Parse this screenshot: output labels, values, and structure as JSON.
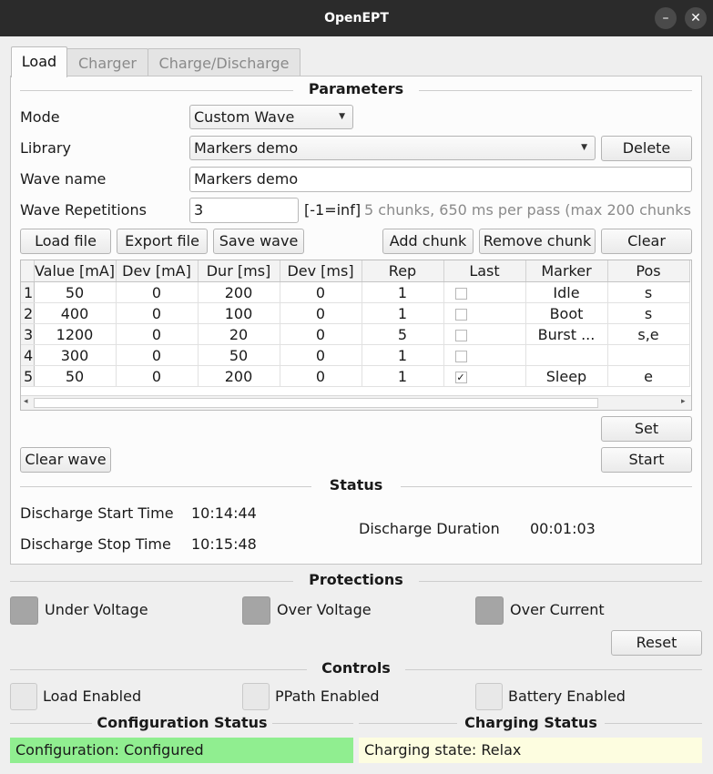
{
  "window": {
    "title": "OpenEPT",
    "minimize_glyph": "–",
    "close_glyph": "✕"
  },
  "tabs": [
    {
      "label": "Load",
      "active": true
    },
    {
      "label": "Charger",
      "active": false
    },
    {
      "label": "Charge/Discharge",
      "active": false
    }
  ],
  "parameters": {
    "title": "Parameters",
    "mode_label": "Mode",
    "mode_value": "Custom Wave",
    "library_label": "Library",
    "library_value": "Markers demo",
    "delete_label": "Delete",
    "wave_name_label": "Wave name",
    "wave_name_value": "Markers demo",
    "repetitions_label": "Wave Repetitions",
    "repetitions_value": "3",
    "repetitions_hint": "[-1=inf]",
    "chunk_info": "5 chunks, 650 ms per pass (max 200 chunks",
    "buttons": {
      "load_file": "Load file",
      "export_file": "Export file",
      "save_wave": "Save wave",
      "add_chunk": "Add chunk",
      "remove_chunk": "Remove chunk",
      "clear": "Clear"
    }
  },
  "table": {
    "columns": [
      "Value [mA]",
      "Dev [mA]",
      "Dur [ms]",
      "Dev [ms]",
      "Rep",
      "Last",
      "Marker",
      "Pos"
    ],
    "rows": [
      {
        "n": "1",
        "value": "50",
        "dev_ma": "0",
        "dur": "200",
        "dev_ms": "0",
        "rep": "1",
        "last": false,
        "marker": "Idle",
        "pos": "s"
      },
      {
        "n": "2",
        "value": "400",
        "dev_ma": "0",
        "dur": "100",
        "dev_ms": "0",
        "rep": "1",
        "last": false,
        "marker": "Boot",
        "pos": "s"
      },
      {
        "n": "3",
        "value": "1200",
        "dev_ma": "0",
        "dur": "20",
        "dev_ms": "0",
        "rep": "5",
        "last": false,
        "marker": "Burst ...",
        "pos": "s,e"
      },
      {
        "n": "4",
        "value": "300",
        "dev_ma": "0",
        "dur": "50",
        "dev_ms": "0",
        "rep": "1",
        "last": false,
        "marker": "",
        "pos": ""
      },
      {
        "n": "5",
        "value": "50",
        "dev_ma": "0",
        "dur": "200",
        "dev_ms": "0",
        "rep": "1",
        "last": true,
        "marker": "Sleep",
        "pos": "e"
      }
    ],
    "check_glyph": "✓",
    "scroll_left_glyph": "◂",
    "scroll_right_glyph": "▸"
  },
  "actions": {
    "set": "Set",
    "start": "Start",
    "clear_wave": "Clear wave"
  },
  "status": {
    "title": "Status",
    "start_label": "Discharge Start Time",
    "start_value": "10:14:44",
    "stop_label": "Discharge Stop Time",
    "stop_value": "10:15:48",
    "duration_label": "Discharge Duration",
    "duration_value": "00:01:03"
  },
  "protections": {
    "title": "Protections",
    "under_voltage": "Under Voltage",
    "over_voltage": "Over Voltage",
    "over_current": "Over Current",
    "reset": "Reset"
  },
  "controls": {
    "title": "Controls",
    "load_enabled": "Load Enabled",
    "ppath_enabled": "PPath Enabled",
    "battery_enabled": "Battery Enabled"
  },
  "config_status": {
    "title": "Configuration Status",
    "text": "Configuration: Configured",
    "color": "#90ee90"
  },
  "charging_status": {
    "title": "Charging Status",
    "text": "Charging state: Relax",
    "color": "#fdfde0"
  }
}
